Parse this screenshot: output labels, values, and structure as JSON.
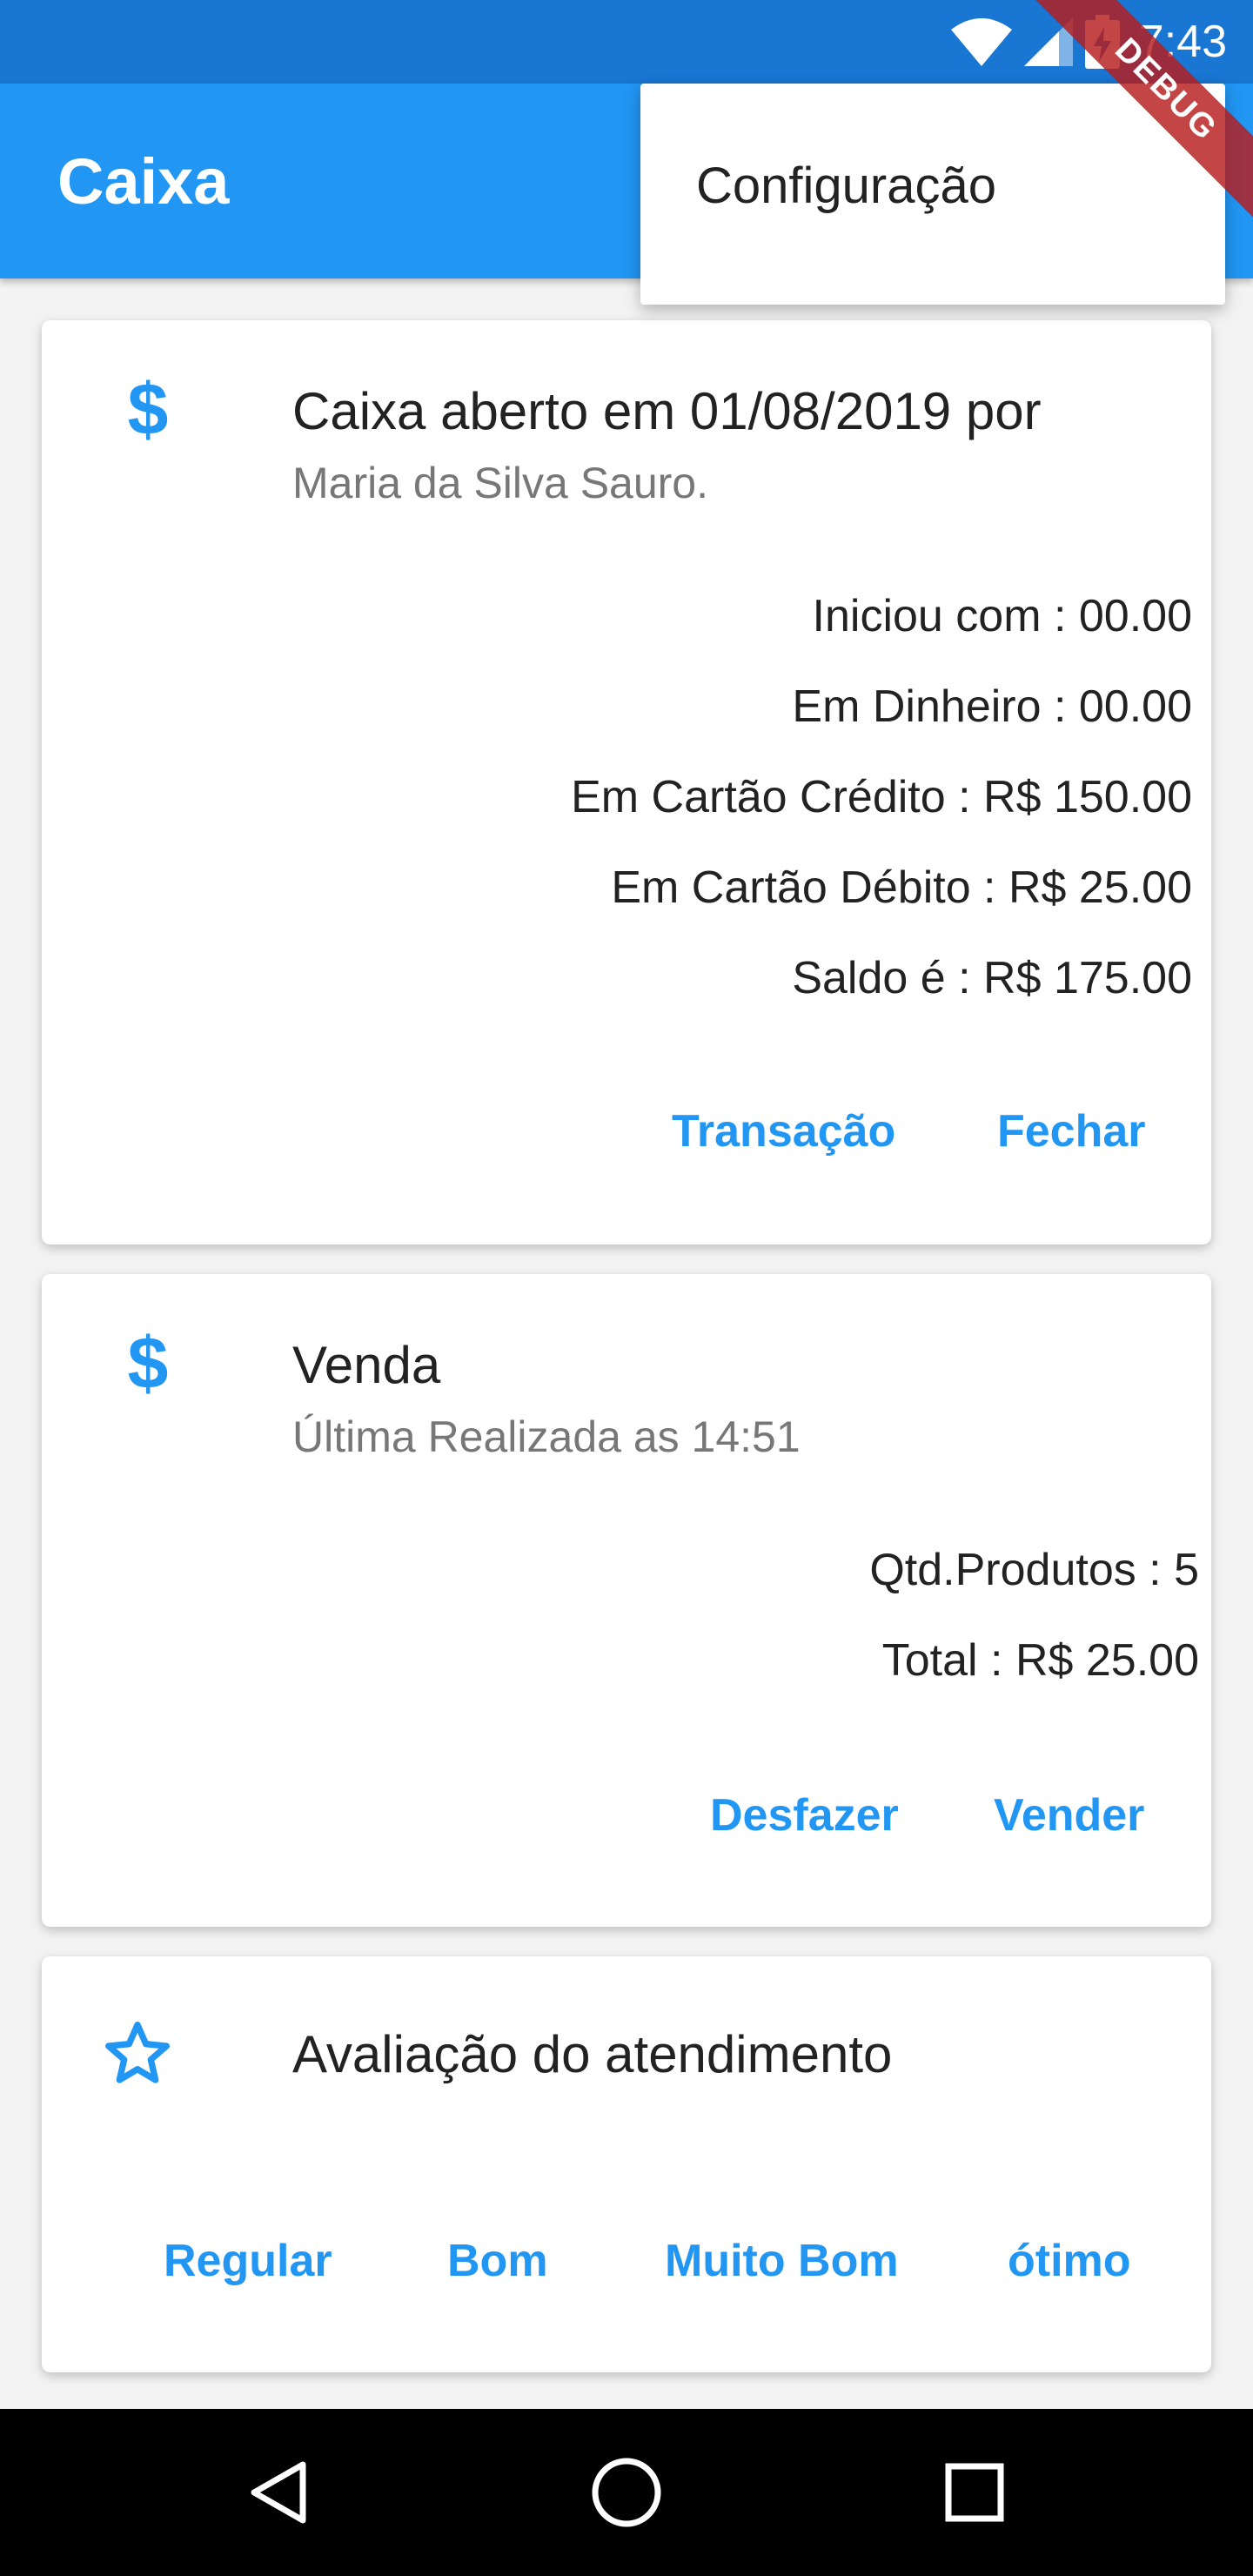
{
  "status_bar": {
    "time": "7:43",
    "icons": [
      "wifi-icon",
      "cell-signal-icon",
      "battery-charging-icon"
    ]
  },
  "app_bar": {
    "title": "Caixa"
  },
  "debug_banner": "DEBUG",
  "menu": {
    "items": [
      {
        "label": "Configuração"
      }
    ]
  },
  "cards": [
    {
      "icon": "dollar-icon",
      "title": "Caixa aberto em 01/08/2019 por",
      "subtitle": "Maria da Silva Sauro.",
      "lines": [
        "Iniciou com : 00.00",
        "Em Dinheiro : 00.00",
        "Em Cartão Crédito : R$ 150.00",
        "Em Cartão Débito : R$ 25.00",
        "Saldo é : R$ 175.00"
      ],
      "actions": [
        "Transação",
        "Fechar"
      ]
    },
    {
      "icon": "dollar-icon",
      "title": "Venda",
      "subtitle": "Última Realizada as 14:51",
      "lines": [
        "Qtd.Produtos : 5",
        "Total : R$ 25.00"
      ],
      "actions": [
        "Desfazer",
        "Vender"
      ]
    },
    {
      "icon": "star-icon",
      "title": "Avaliação do atendimento",
      "actions": [
        "Regular",
        "Bom",
        "Muito Bom",
        "ótimo"
      ]
    }
  ],
  "nav_bar": {
    "buttons": [
      "back-icon",
      "home-icon",
      "recents-icon"
    ]
  },
  "colors": {
    "primary": "#2196f3",
    "primary_dark": "#1976d2",
    "debug": "#b71c1c"
  }
}
